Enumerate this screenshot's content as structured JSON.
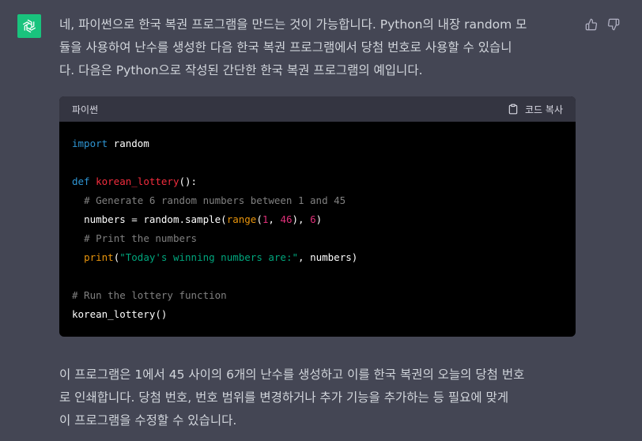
{
  "message": {
    "intro": "네, 파이썬으로 한국 복권 프로그램을 만드는 것이 가능합니다. Python의 내장 random 모\n듈을 사용하여 난수를 생성한 다음 한국 복권 프로그램에서 당첨 번호로 사용할 수 있습니\n다. 다음은 Python으로 작성된 간단한 한국 복권 프로그램의 예입니다.",
    "outro": "이 프로그램은 1에서 45 사이의 6개의 난수를 생성하고 이를 한국 복권의 오늘의 당첨 번호\n로 인쇄합니다. 당첨 번호, 번호 범위를 변경하거나 추가 기능을 추가하는 등 필요에 맞게\n이 프로그램을 수정할 수 있습니다."
  },
  "code_block": {
    "language": "파이썬",
    "copy_label": "코드 복사",
    "lines": [
      {
        "indent": "",
        "tokens": [
          {
            "t": "import",
            "c": "kw"
          },
          {
            "t": " random",
            "c": ""
          }
        ]
      },
      {
        "indent": "",
        "tokens": []
      },
      {
        "indent": "",
        "tokens": [
          {
            "t": "def",
            "c": "kw"
          },
          {
            "t": " ",
            "c": ""
          },
          {
            "t": "korean_lottery",
            "c": "fn"
          },
          {
            "t": "():",
            "c": ""
          }
        ]
      },
      {
        "indent": "  ",
        "tokens": [
          {
            "t": "# Generate 6 random numbers between 1 and 45",
            "c": "cm"
          }
        ]
      },
      {
        "indent": "  ",
        "tokens": [
          {
            "t": "numbers = random.sample(",
            "c": ""
          },
          {
            "t": "range",
            "c": "bi"
          },
          {
            "t": "(",
            "c": ""
          },
          {
            "t": "1",
            "c": "num"
          },
          {
            "t": ", ",
            "c": ""
          },
          {
            "t": "46",
            "c": "num"
          },
          {
            "t": "), ",
            "c": ""
          },
          {
            "t": "6",
            "c": "num"
          },
          {
            "t": ")",
            "c": ""
          }
        ]
      },
      {
        "indent": "  ",
        "tokens": [
          {
            "t": "# Print the numbers",
            "c": "cm"
          }
        ]
      },
      {
        "indent": "  ",
        "tokens": [
          {
            "t": "print",
            "c": "bi"
          },
          {
            "t": "(",
            "c": ""
          },
          {
            "t": "\"Today's winning numbers are:\"",
            "c": "str"
          },
          {
            "t": ", numbers)",
            "c": ""
          }
        ]
      },
      {
        "indent": "",
        "tokens": []
      },
      {
        "indent": "",
        "tokens": [
          {
            "t": "# Run the lottery function",
            "c": "cm"
          }
        ]
      },
      {
        "indent": "",
        "tokens": [
          {
            "t": "korean_lottery()",
            "c": ""
          }
        ]
      }
    ]
  },
  "icons": {
    "avatar": "openai-logo-icon",
    "thumbs_up": "thumbs-up-icon",
    "thumbs_down": "thumbs-down-icon",
    "copy": "clipboard-icon"
  },
  "colors": {
    "background": "#444654",
    "avatar_bg": "#19c37d",
    "code_bg": "#000000",
    "code_header_bg": "#343541",
    "keyword": "#2e95d3",
    "function": "#f22c3d",
    "number": "#df3079",
    "builtin": "#e9950c",
    "string": "#00a67d"
  }
}
